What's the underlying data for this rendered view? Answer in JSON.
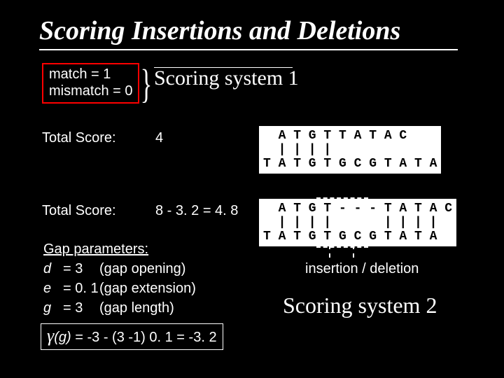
{
  "title": "Scoring Insertions and Deletions",
  "scoring_box": {
    "line1": "match = 1",
    "line2": "mismatch = 0"
  },
  "brace": "}",
  "scoring_system_1": "Scoring system 1",
  "total_score_label": "Total Score:",
  "score1_value": "4",
  "score2_value": "8 - 3. 2 = 4. 8",
  "alignment1": {
    "row1": "  A T G T T A T A C",
    "row2": "  | | | |",
    "row3": "T A T G T G C G T A T A"
  },
  "alignment2": {
    "row1": "  A T G T - - - T A T A C",
    "row2": "  | | | |       | | | |",
    "row3": "T A T G T G C G T A T A"
  },
  "gap_parameters": {
    "header": "Gap parameters:",
    "d_sym": "d",
    "d_val": "= 3",
    "d_desc": "(gap opening)",
    "e_sym": "e",
    "e_val": "= 0. 1",
    "e_desc": "(gap extension)",
    "g_sym": "g",
    "g_val": "= 3",
    "g_desc": "(gap length)"
  },
  "gamma": {
    "sym": "γ",
    "g": "(g)",
    "rest": " = -3 - (3 -1) 0. 1 = -3. 2"
  },
  "indel_label": "insertion / deletion",
  "scoring_system_2": "Scoring system 2"
}
